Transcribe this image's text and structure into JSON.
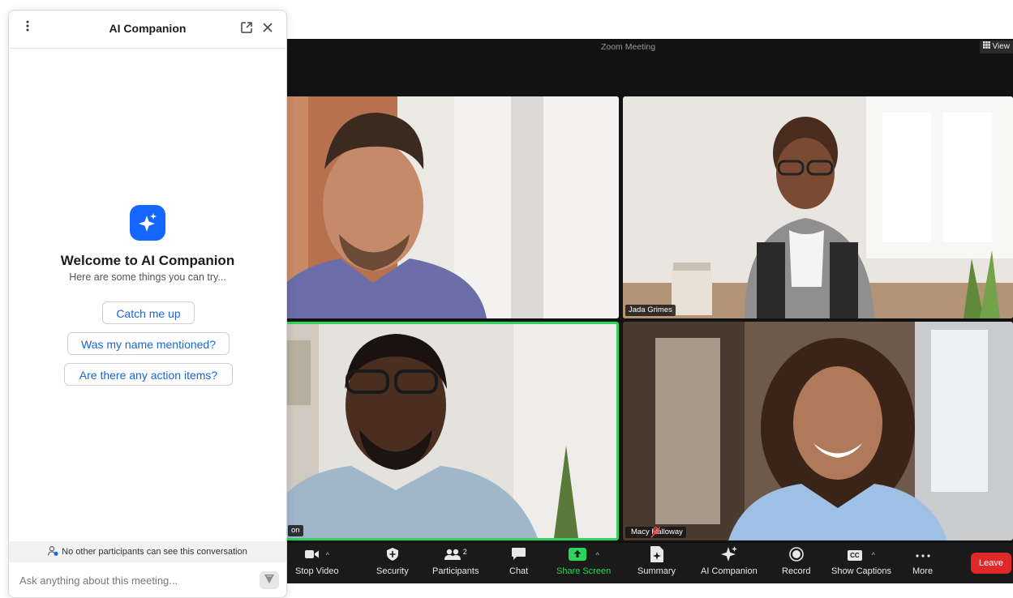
{
  "zoom": {
    "title": "Zoom Meeting",
    "view_label": "View",
    "participants": [
      {
        "name": ""
      },
      {
        "name": "Jada Grimes"
      },
      {
        "name": "on"
      },
      {
        "name": "Macy Halloway"
      }
    ],
    "active_speaker_color": "#2cd45a",
    "toolbar": {
      "stop_video": "Stop Video",
      "security": "Security",
      "participants": "Participants",
      "participants_count": "2",
      "chat": "Chat",
      "share_screen": "Share Screen",
      "summary": "Summary",
      "ai_companion": "AI Companion",
      "record": "Record",
      "show_captions": "Show Captions",
      "cc_badge": "CC",
      "more": "More",
      "leave": "Leave"
    }
  },
  "panel": {
    "title": "AI Companion",
    "welcome_title": "Welcome to AI Companion",
    "welcome_subtitle": "Here are some things you can try...",
    "suggestions": [
      "Catch me up",
      "Was my name mentioned?",
      "Are there any action items?"
    ],
    "privacy_note": "No other participants can see this conversation",
    "input_placeholder": "Ask anything about this meeting...",
    "accent_color": "#1566ff"
  }
}
